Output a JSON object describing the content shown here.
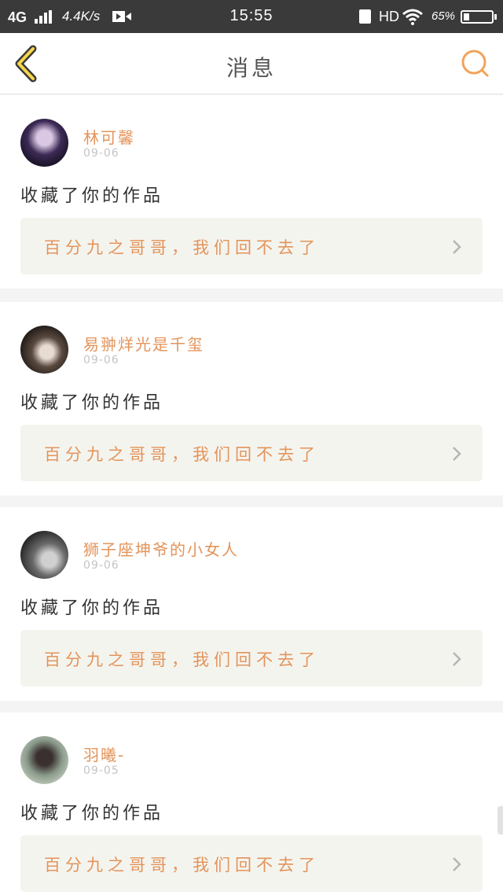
{
  "status_bar": {
    "network": "4G",
    "speed": "4.4K/s",
    "time": "15:55",
    "hd": "HD",
    "battery_pct": "65%",
    "battery_level": 0.15
  },
  "header": {
    "title": "消息",
    "accent_color": "#f2a35b"
  },
  "messages": [
    {
      "user": "林可馨",
      "date": "09-06",
      "action": "收藏了你的作品",
      "work_title": "百分九之哥哥，我们回不去了"
    },
    {
      "user": "易翀烊光是千玺",
      "date": "09-06",
      "action": "收藏了你的作品",
      "work_title": "百分九之哥哥，我们回不去了"
    },
    {
      "user": "狮子座坤爷的小女人",
      "date": "09-06",
      "action": "收藏了你的作品",
      "work_title": "百分九之哥哥，我们回不去了"
    },
    {
      "user": "羽曦-",
      "date": "09-05",
      "action": "收藏了你的作品",
      "work_title": "百分九之哥哥，我们回不去了"
    }
  ],
  "colors": {
    "username": "#e3945a",
    "work_title": "#e3945a",
    "work_bg": "#f4f4ef",
    "divider": "#f4f4f4"
  }
}
